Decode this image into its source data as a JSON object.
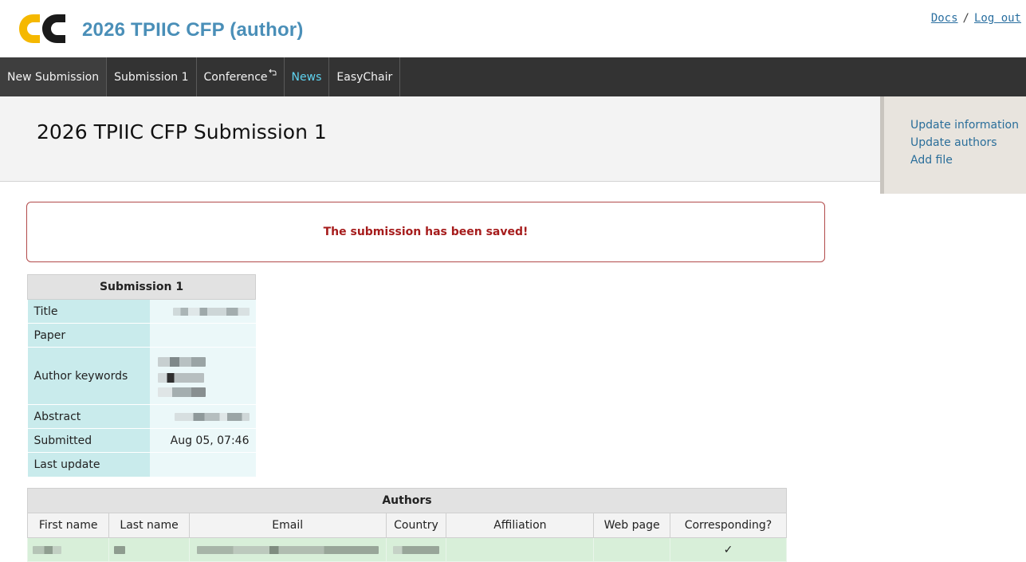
{
  "app": {
    "title": "2026 TPIIC CFP (author)",
    "logo_colors": {
      "primary": "#f5b800",
      "secondary": "#1a1a1a"
    }
  },
  "top_links": {
    "docs": "Docs",
    "separator": "/",
    "logout": "Log out"
  },
  "nav": {
    "items": [
      {
        "label": "New Submission"
      },
      {
        "label": "Submission 1"
      },
      {
        "label": "Conference"
      },
      {
        "label": "News"
      },
      {
        "label": "EasyChair"
      }
    ],
    "news_color": "#5fd3f0"
  },
  "page": {
    "title": "2026 TPIIC CFP Submission 1"
  },
  "side_menu": {
    "items": [
      {
        "label": "Update information"
      },
      {
        "label": "Update authors"
      },
      {
        "label": "Add file"
      }
    ]
  },
  "alert": {
    "message": "The submission has been saved!",
    "color": "#a61c1c"
  },
  "submission": {
    "heading": "Submission 1",
    "rows": [
      {
        "label": "Title",
        "value": ""
      },
      {
        "label": "Paper",
        "value": ""
      },
      {
        "label": "Author keywords",
        "value": ""
      },
      {
        "label": "Abstract",
        "value": ""
      },
      {
        "label": "Submitted",
        "value": "Aug 05, 07:46"
      },
      {
        "label": "Last update",
        "value": ""
      }
    ]
  },
  "authors": {
    "heading": "Authors",
    "columns": [
      "First name",
      "Last name",
      "Email",
      "Country",
      "Affiliation",
      "Web page",
      "Corresponding?"
    ],
    "rows": [
      {
        "corresponding": "✓"
      }
    ]
  }
}
